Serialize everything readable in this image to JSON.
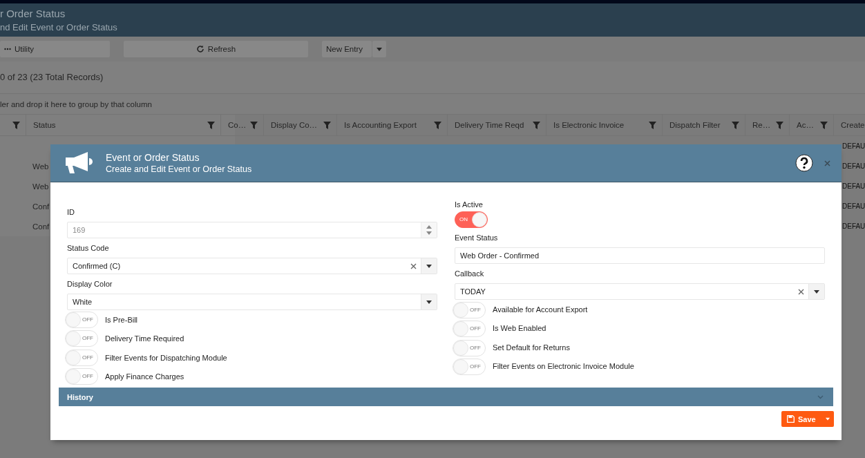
{
  "page_header": {
    "title": "r Order Status",
    "subtitle": "nd Edit Event or Order Status"
  },
  "toolbar": {
    "utility": "Utility",
    "refresh": "Refresh",
    "new_entry": "New Entry"
  },
  "pager": "0 of 23 (23 Total Records)",
  "group_hint": "ler and drop it here to group by that column",
  "table": {
    "columns": [
      "Status",
      "Co…",
      "Display Co…",
      "Is Accounting Export",
      "Delivery Time Reqd",
      "Is Electronic Invoice",
      "Dispatch Filter",
      "Re…",
      "Ac…",
      "Create"
    ],
    "rows": [
      {
        "cells": [
          null,
          null,
          null,
          null,
          null,
          null,
          null,
          null,
          null,
          "DEFAU"
        ]
      },
      {
        "cells": [
          "Web",
          null,
          null,
          null,
          null,
          null,
          null,
          null,
          null,
          "DEFAU"
        ]
      },
      {
        "cells": [
          "Web",
          null,
          null,
          null,
          null,
          null,
          null,
          null,
          null,
          "DEFAU"
        ]
      },
      {
        "cells": [
          "Conf",
          null,
          null,
          null,
          null,
          null,
          null,
          null,
          null,
          "DEFAU"
        ]
      },
      {
        "cells": [
          "Conf",
          null,
          null,
          null,
          null,
          null,
          null,
          null,
          null,
          "DEFAU"
        ]
      }
    ]
  },
  "modal": {
    "title": "Event or Order Status",
    "subtitle": "Create and Edit Event or Order Status",
    "left_fields": [
      {
        "kind": "number",
        "label": "ID",
        "value": "169",
        "disabled": true
      },
      {
        "kind": "select",
        "label": "Status Code",
        "value": "Confirmed (C)",
        "clearable": true
      },
      {
        "kind": "select",
        "label": "Display Color",
        "value": "White",
        "clearable": false
      }
    ],
    "left_toggles": [
      {
        "label": "Is Pre-Bill",
        "on": false,
        "state_text": "OFF"
      },
      {
        "label": "Delivery Time Required",
        "on": false,
        "state_text": "OFF"
      },
      {
        "label": "Filter Events for Dispatching Module",
        "on": false,
        "state_text": "OFF"
      },
      {
        "label": "Apply Finance Charges",
        "on": false,
        "state_text": "OFF"
      }
    ],
    "is_active": {
      "label": "Is Active",
      "on": true,
      "state_text": "ON"
    },
    "right_fields": [
      {
        "kind": "text",
        "label": "Event Status",
        "value": "Web Order - Confirmed"
      },
      {
        "kind": "select",
        "label": "Callback",
        "value": "TODAY",
        "clearable": true
      }
    ],
    "right_toggles": [
      {
        "label": "Available for Account Export",
        "on": false,
        "state_text": "OFF"
      },
      {
        "label": "Is Web Enabled",
        "on": false,
        "state_text": "OFF"
      },
      {
        "label": "Set Default for Returns",
        "on": false,
        "state_text": "OFF"
      },
      {
        "label": "Filter Events on Electronic Invoice Module",
        "on": false,
        "state_text": "OFF"
      }
    ],
    "history": {
      "label": "History",
      "expanded": false
    },
    "save": "Save"
  }
}
